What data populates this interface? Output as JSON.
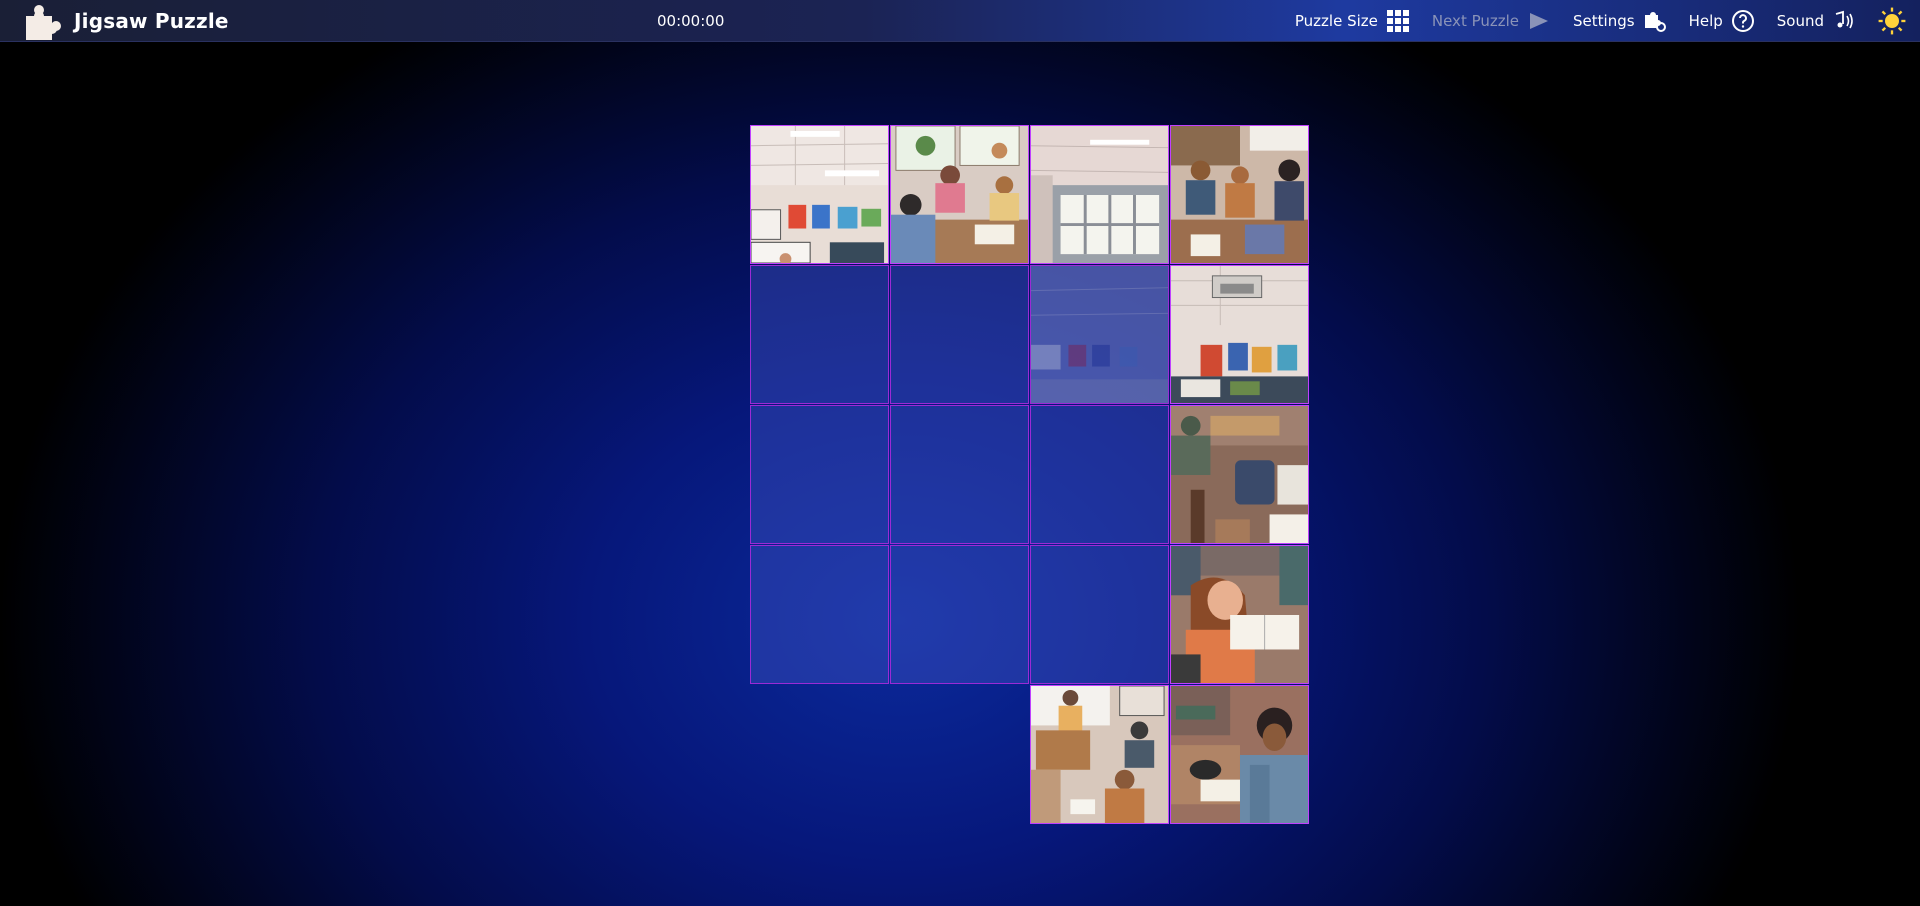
{
  "app": {
    "title": "Jigsaw Puzzle",
    "timer": "00:00:00"
  },
  "menu": {
    "puzzle_size": "Puzzle Size",
    "next_puzzle": "Next Puzzle",
    "settings": "Settings",
    "help": "Help",
    "sound": "Sound"
  },
  "icons": {
    "logo": "puzzle-piece-icon",
    "puzzle_size": "grid-icon",
    "next_puzzle": "play-arrow-icon",
    "settings": "puzzle-gear-icon",
    "help": "question-circle-icon",
    "sound": "music-note-icon",
    "theme": "sun-icon"
  },
  "colors": {
    "accent_border": "#9b2ad6",
    "sun": "#ffd23a",
    "slot_fill": "#3c50be"
  },
  "board": {
    "columns": 4,
    "rows": 5
  }
}
